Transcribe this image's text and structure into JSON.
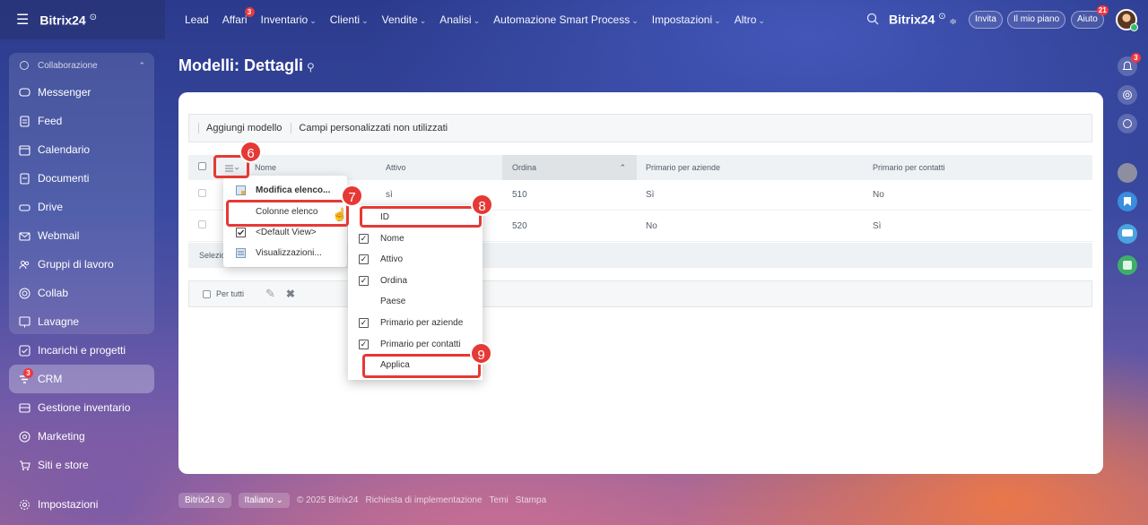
{
  "topbar": {
    "app_name": "Bitrix24",
    "nav": [
      {
        "label": "Lead",
        "caret": false,
        "badge": ""
      },
      {
        "label": "Affari",
        "caret": false,
        "badge": "3"
      },
      {
        "label": "Inventario",
        "caret": true,
        "badge": ""
      },
      {
        "label": "Clienti",
        "caret": true,
        "badge": ""
      },
      {
        "label": "Vendite",
        "caret": true,
        "badge": ""
      },
      {
        "label": "Analisi",
        "caret": true,
        "badge": ""
      },
      {
        "label": "Automazione Smart Process",
        "caret": true,
        "badge": ""
      },
      {
        "label": "Impostazioni",
        "caret": true,
        "badge": ""
      },
      {
        "label": "Altro",
        "caret": true,
        "badge": ""
      }
    ],
    "right_logo": "Bitrix24",
    "invite_label": "Invita",
    "plan_label": "Il mio piano",
    "help_label": "Aiuto",
    "help_badge": "21"
  },
  "sidebar": {
    "group_title": "Collaborazione",
    "group_items": [
      {
        "label": "Messenger",
        "icon": "messenger-icon"
      },
      {
        "label": "Feed",
        "icon": "feed-icon"
      },
      {
        "label": "Calendario",
        "icon": "calendar-icon"
      },
      {
        "label": "Documenti",
        "icon": "documents-icon"
      },
      {
        "label": "Drive",
        "icon": "drive-icon"
      },
      {
        "label": "Webmail",
        "icon": "mail-icon"
      },
      {
        "label": "Gruppi di lavoro",
        "icon": "groups-icon"
      },
      {
        "label": "Collab",
        "icon": "collab-icon"
      },
      {
        "label": "Lavagne",
        "icon": "boards-icon"
      }
    ],
    "items": [
      {
        "label": "Incarichi e progetti",
        "icon": "tasks-icon",
        "active": false,
        "badge": ""
      },
      {
        "label": "CRM",
        "icon": "crm-icon",
        "active": true,
        "badge": "3"
      },
      {
        "label": "Gestione inventario",
        "icon": "inventory-icon",
        "active": false,
        "badge": ""
      },
      {
        "label": "Marketing",
        "icon": "marketing-icon",
        "active": false,
        "badge": ""
      },
      {
        "label": "Siti e store",
        "icon": "cart-icon",
        "active": false,
        "badge": ""
      }
    ],
    "settings_label": "Impostazioni"
  },
  "page": {
    "title": "Modelli: Dettagli"
  },
  "toolbar": {
    "add_model": "Aggiungi modello",
    "unused_fields": "Campi personalizzati non utilizzati"
  },
  "grid": {
    "columns": [
      "Nome",
      "Attivo",
      "Ordina",
      "Primario per aziende",
      "Primario per contatti"
    ],
    "rows": [
      {
        "nome": "",
        "attivo": "sì",
        "ordina": "510",
        "aziende": "Sì",
        "contatti": "No"
      },
      {
        "nome": "",
        "attivo": "",
        "ordina": "520",
        "aziende": "No",
        "contatti": "Sì"
      }
    ],
    "footer_text": "Selezio",
    "for_all_label": "Per tutti"
  },
  "menu_main": {
    "items": [
      "Modifica elenco...",
      "Colonne elenco",
      "<Default View>",
      "Visualizzazioni..."
    ]
  },
  "menu_columns": {
    "items": [
      {
        "label": "ID",
        "checked": false
      },
      {
        "label": "Nome",
        "checked": true
      },
      {
        "label": "Attivo",
        "checked": true
      },
      {
        "label": "Ordina",
        "checked": true
      },
      {
        "label": "Paese",
        "checked": false
      },
      {
        "label": "Primario per aziende",
        "checked": true
      },
      {
        "label": "Primario per contatti",
        "checked": true
      }
    ],
    "apply_label": "Applica"
  },
  "callouts": [
    "6",
    "7",
    "8",
    "9"
  ],
  "right_rail": {
    "notification_badge": "3"
  },
  "footer": {
    "brand": "Bitrix24",
    "language": "Italiano",
    "copyright": "© 2025 Bitrix24",
    "implementation": "Richiesta di implementazione",
    "themes": "Temi",
    "print": "Stampa"
  },
  "colors": {
    "accent_red": "#e53935",
    "badge_red": "#f0383d"
  }
}
